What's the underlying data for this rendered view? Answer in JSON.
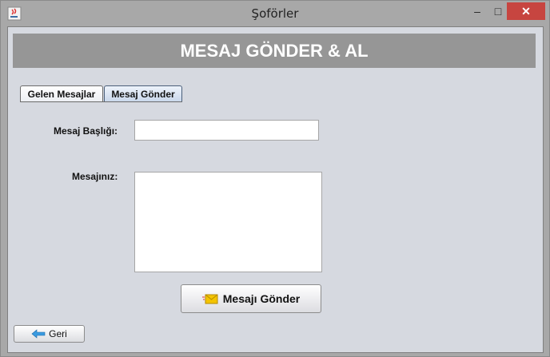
{
  "window": {
    "title": "Şoförler",
    "minimize": "–",
    "maximize": "□",
    "close": "✕"
  },
  "header": {
    "title": "MESAJ GÖNDER & AL"
  },
  "tabs": [
    {
      "label": "Gelen Mesajlar",
      "selected": false
    },
    {
      "label": "Mesaj Gönder",
      "selected": true
    }
  ],
  "form": {
    "title_label": "Mesaj Başlığı:",
    "title_value": "",
    "message_label": "Mesajınız:",
    "message_value": "",
    "send_label": "Mesajı Gönder",
    "send_icon": "envelope-icon"
  },
  "back": {
    "label": "Geri",
    "icon": "arrow-left-icon"
  },
  "colors": {
    "header": "#969696",
    "close": "#c74540",
    "panel": "#d6d9e0"
  }
}
